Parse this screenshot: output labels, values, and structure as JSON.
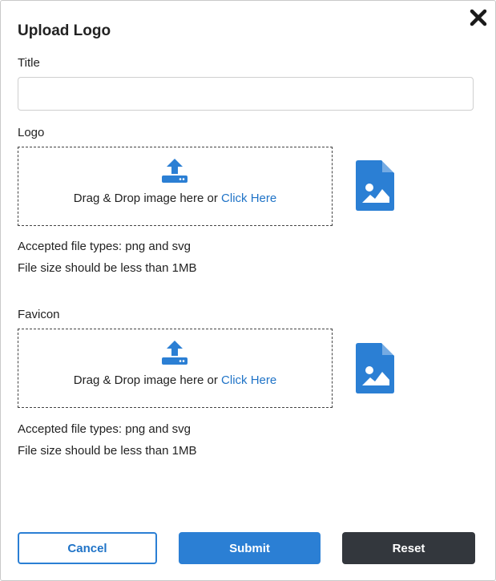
{
  "dialog": {
    "title": "Upload Logo",
    "close_icon": "close-icon"
  },
  "form": {
    "title_label": "Title",
    "title_value": "",
    "title_placeholder": ""
  },
  "logo": {
    "label": "Logo",
    "drop_text": "Drag & Drop image here or ",
    "link_text": "Click Here",
    "upload_icon": "upload-icon",
    "preview_icon": "image-file-icon",
    "accepted_types": "Accepted file types: png and svg",
    "size_note": "File size should be less than 1MB"
  },
  "favicon": {
    "label": "Favicon",
    "drop_text": "Drag & Drop image here or ",
    "link_text": "Click Here",
    "upload_icon": "upload-icon",
    "preview_icon": "image-file-icon",
    "accepted_types": "Accepted file types: png and svg",
    "size_note": "File size should be less than 1MB"
  },
  "buttons": {
    "cancel": "Cancel",
    "submit": "Submit",
    "reset": "Reset"
  },
  "colors": {
    "accent": "#2b7fd4",
    "link": "#1f73c7",
    "reset_bg": "#33373d"
  }
}
